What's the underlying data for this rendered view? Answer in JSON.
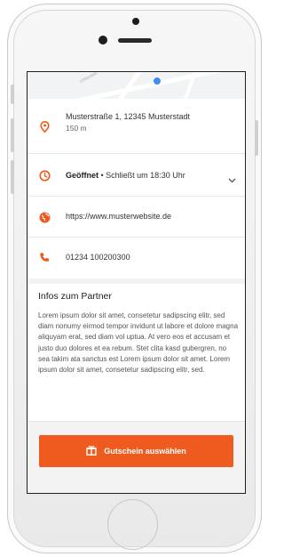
{
  "address": {
    "street": "Musterstraße 1, 12345 Musterstadt",
    "distance": "150 m"
  },
  "hours": {
    "status": "Geöffnet",
    "detail": "• Schließt um 18:30 Uhr"
  },
  "website": {
    "url": "https://www.musterwebsite.de"
  },
  "phone": {
    "number": "01234 100200300"
  },
  "info": {
    "title": "Infos zum Partner",
    "body": "Lorem ipsum dolor sit amet, consetetur sadipscing elitr, sed diam nonumy eirmod tempor invidunt ut labore et dolore magna aliquyam erat, sed diam vol uptua. At vero eos et accusam et justo duo dolores et ea rebum. Stet clita kasd gubergren, no sea takim ata sanctus est Lorem ipsum dolor sit amet. Lorem ipsum dolor sit amet, consetetur sadipscing elitr, sed."
  },
  "cta": {
    "label": "Gutschein auswählen"
  },
  "map": {
    "street_label": "Uhlandstr."
  },
  "colors": {
    "accent": "#ef5b1f",
    "pin": "#3f8ef5"
  },
  "icons": [
    "location-pin-icon",
    "clock-icon",
    "globe-icon",
    "phone-icon",
    "chevron-down-icon",
    "gift-icon"
  ]
}
